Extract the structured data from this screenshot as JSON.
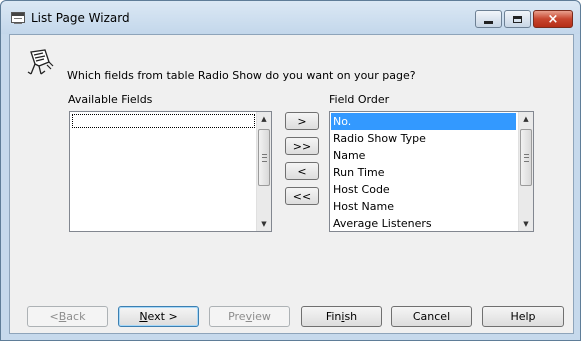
{
  "window": {
    "title": "List Page Wizard",
    "controls": [
      "minimize-icon",
      "maximize-icon",
      "close-icon"
    ],
    "close_glyph": "×"
  },
  "wizard": {
    "icon": "wizard-icon",
    "question": "Which fields from table Radio Show do you want on your page?",
    "available_label": "Available Fields",
    "order_label": "Field Order",
    "available_fields": [],
    "field_order": [
      "No.",
      "Radio Show Type",
      "Name",
      "Run Time",
      "Host Code",
      "Host Name",
      "Average Listeners"
    ],
    "selected_field": "No."
  },
  "move_buttons": {
    "add": ">",
    "add_all": ">>",
    "remove": "<",
    "remove_all": "<<"
  },
  "footer": {
    "back": {
      "pre": "< ",
      "key": "B",
      "post": "ack"
    },
    "next": {
      "pre": "",
      "key": "N",
      "post": "ext >"
    },
    "preview": {
      "pre": "Pre",
      "key": "v",
      "post": "iew"
    },
    "finish": {
      "pre": "Fin",
      "key": "i",
      "post": "sh"
    },
    "cancel": "Cancel",
    "help": "Help"
  },
  "colors": {
    "selection": "#3399ff",
    "close_button": "#c7452e",
    "frame": "#c6d9ec"
  }
}
